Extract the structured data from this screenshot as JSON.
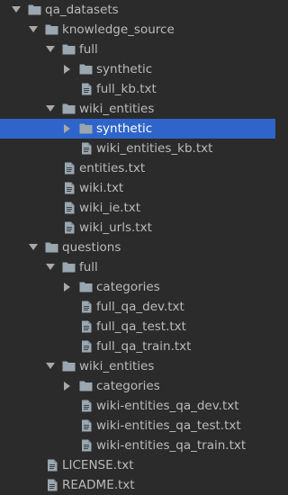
{
  "tree": {
    "items": [
      {
        "label": "qa_datasets",
        "type": "folder",
        "expanded": true,
        "depth": 0
      },
      {
        "label": "knowledge_source",
        "type": "folder",
        "expanded": true,
        "depth": 1
      },
      {
        "label": "full",
        "type": "folder",
        "expanded": true,
        "depth": 2
      },
      {
        "label": "synthetic",
        "type": "folder",
        "expanded": false,
        "depth": 3
      },
      {
        "label": "full_kb.txt",
        "type": "file",
        "depth": 3
      },
      {
        "label": "wiki_entities",
        "type": "folder",
        "expanded": true,
        "depth": 2
      },
      {
        "label": "synthetic",
        "type": "folder",
        "expanded": false,
        "depth": 3,
        "selected": true
      },
      {
        "label": "wiki_entities_kb.txt",
        "type": "file",
        "depth": 3
      },
      {
        "label": "entities.txt",
        "type": "file",
        "depth": 2
      },
      {
        "label": "wiki.txt",
        "type": "file",
        "depth": 2
      },
      {
        "label": "wiki_ie.txt",
        "type": "file",
        "depth": 2
      },
      {
        "label": "wiki_urls.txt",
        "type": "file",
        "depth": 2
      },
      {
        "label": "questions",
        "type": "folder",
        "expanded": true,
        "depth": 1
      },
      {
        "label": "full",
        "type": "folder",
        "expanded": true,
        "depth": 2
      },
      {
        "label": "categories",
        "type": "folder",
        "expanded": false,
        "depth": 3
      },
      {
        "label": "full_qa_dev.txt",
        "type": "file",
        "depth": 3
      },
      {
        "label": "full_qa_test.txt",
        "type": "file",
        "depth": 3
      },
      {
        "label": "full_qa_train.txt",
        "type": "file",
        "depth": 3
      },
      {
        "label": "wiki_entities",
        "type": "folder",
        "expanded": true,
        "depth": 2
      },
      {
        "label": "categories",
        "type": "folder",
        "expanded": false,
        "depth": 3
      },
      {
        "label": "wiki-entities_qa_dev.txt",
        "type": "file",
        "depth": 3
      },
      {
        "label": "wiki-entities_qa_test.txt",
        "type": "file",
        "depth": 3
      },
      {
        "label": "wiki-entities_qa_train.txt",
        "type": "file",
        "depth": 3
      },
      {
        "label": "LICENSE.txt",
        "type": "file",
        "depth": 1
      },
      {
        "label": "README.txt",
        "type": "file",
        "depth": 1
      }
    ]
  },
  "colors": {
    "background": "#2b2b2b",
    "text": "#bbbbbb",
    "selection": "#2f65ca",
    "folder": "#9aa7b0",
    "file": "#9aa7b0",
    "arrow": "#a8a8a8"
  },
  "icons": {
    "expanded": "chevron-down-icon",
    "collapsed": "chevron-right-icon",
    "folder": "folder-icon",
    "file": "text-file-icon"
  }
}
